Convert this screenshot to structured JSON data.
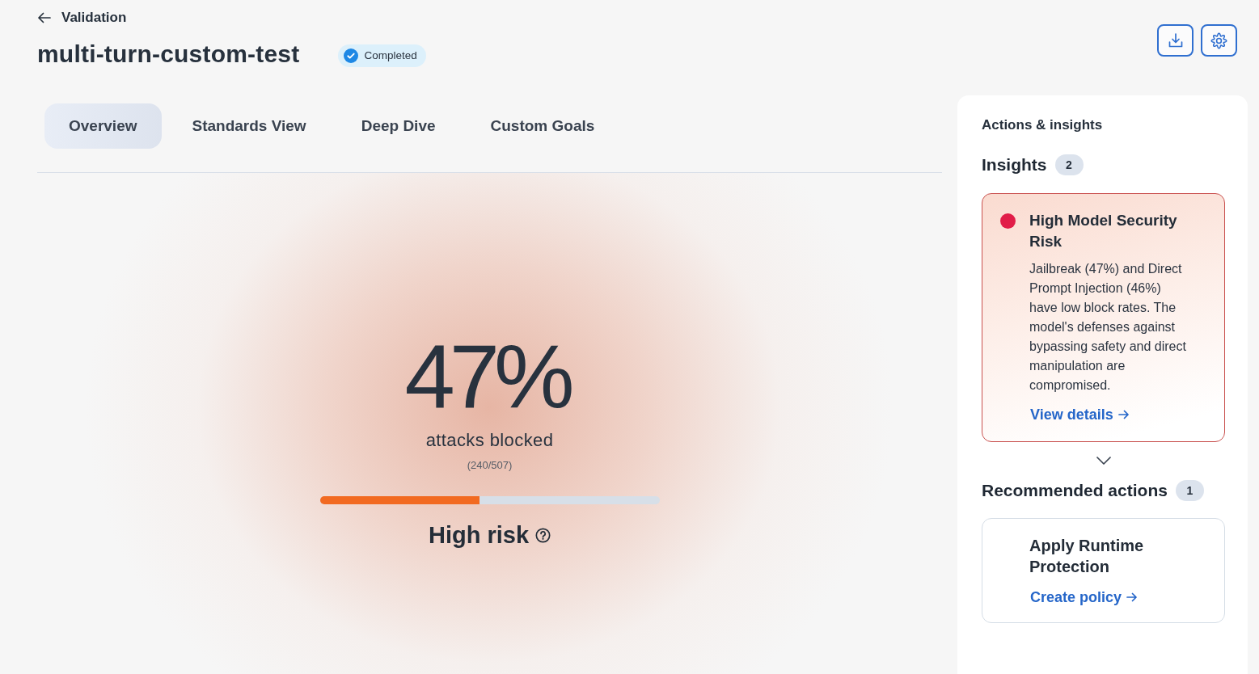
{
  "header": {
    "back": "Validation",
    "title": "multi-turn-custom-test",
    "status": "Completed"
  },
  "tabs": [
    {
      "label": "Overview",
      "selected": true
    },
    {
      "label": "Standards View",
      "selected": false
    },
    {
      "label": "Deep Dive",
      "selected": false
    },
    {
      "label": "Custom Goals",
      "selected": false
    }
  ],
  "score": {
    "value": "47%",
    "caption": "attacks blocked",
    "count": "(240/507)",
    "level": 0.47,
    "risk": "High risk"
  },
  "panel": {
    "title": "Actions & insights",
    "insights": {
      "title": "Insights",
      "count": "2",
      "items": [
        {
          "title": "High Model Security Risk",
          "color": "#e11d48",
          "body": "Jailbreak (47%) and Direct Prompt Injection (46%) have low block rates. The model's defenses against bypassing safety and direct manipulation are compromised.",
          "link": "View details"
        }
      ]
    },
    "recommended": {
      "title": "Recommended actions",
      "count": "1",
      "items": [
        {
          "title": "Apply Runtime Protection",
          "link": "Create policy"
        }
      ]
    }
  }
}
